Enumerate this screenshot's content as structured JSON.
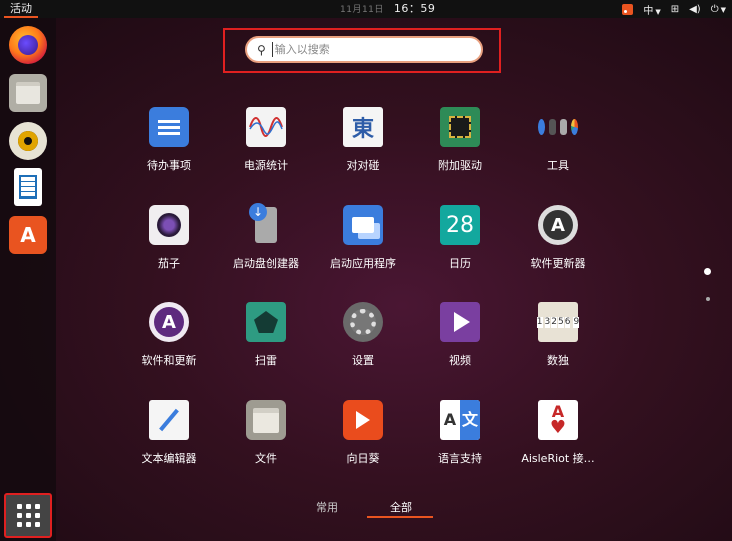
{
  "topbar": {
    "activities": "活动",
    "date_dim": "11月11日",
    "clock": "16：59",
    "input_method": "中",
    "icons": [
      "rss-icon",
      "network-icon",
      "volume-icon",
      "power-icon"
    ]
  },
  "dock": {
    "items": [
      "firefox",
      "files",
      "rhythmbox",
      "libreoffice-writer",
      "ubuntu-software"
    ],
    "show_apps": "show-applications"
  },
  "search": {
    "placeholder": "输入以搜索",
    "value": ""
  },
  "apps": [
    {
      "label": "待办事项",
      "icon": "todo-icon"
    },
    {
      "label": "电源统计",
      "icon": "power-statistics-icon"
    },
    {
      "label": "对对碰",
      "icon": "character-map-icon",
      "glyph": "東"
    },
    {
      "label": "附加驱动",
      "icon": "additional-drivers-icon"
    },
    {
      "label": "工具",
      "icon": "utilities-folder-icon"
    },
    {
      "label": "茄子",
      "icon": "cheese-icon"
    },
    {
      "label": "启动盘创建器",
      "icon": "usb-creator-icon"
    },
    {
      "label": "启动应用程序",
      "icon": "startup-applications-icon"
    },
    {
      "label": "日历",
      "icon": "calendar-icon",
      "glyph": "28"
    },
    {
      "label": "软件更新器",
      "icon": "software-updater-icon",
      "glyph": "A"
    },
    {
      "label": "软件和更新",
      "icon": "software-properties-icon",
      "glyph": "A"
    },
    {
      "label": "扫雷",
      "icon": "mines-icon"
    },
    {
      "label": "设置",
      "icon": "settings-icon"
    },
    {
      "label": "视频",
      "icon": "videos-icon"
    },
    {
      "label": "数独",
      "icon": "sudoku-icon",
      "cells": [
        "1",
        "",
        "3",
        "2",
        "5",
        "6",
        "",
        "",
        "9"
      ]
    },
    {
      "label": "文本编辑器",
      "icon": "text-editor-icon"
    },
    {
      "label": "文件",
      "icon": "files-icon"
    },
    {
      "label": "向日葵",
      "icon": "sunlogin-icon"
    },
    {
      "label": "语言支持",
      "icon": "language-support-icon",
      "glyph_a": "A",
      "glyph_b": "文"
    },
    {
      "label": "AisleRiot 接…",
      "icon": "aisleriot-icon",
      "glyph": "A",
      "suit": "♥"
    }
  ],
  "tabs": {
    "frequent": "常用",
    "all": "全部"
  },
  "accent": "#e95420",
  "highlight": "#e02020"
}
